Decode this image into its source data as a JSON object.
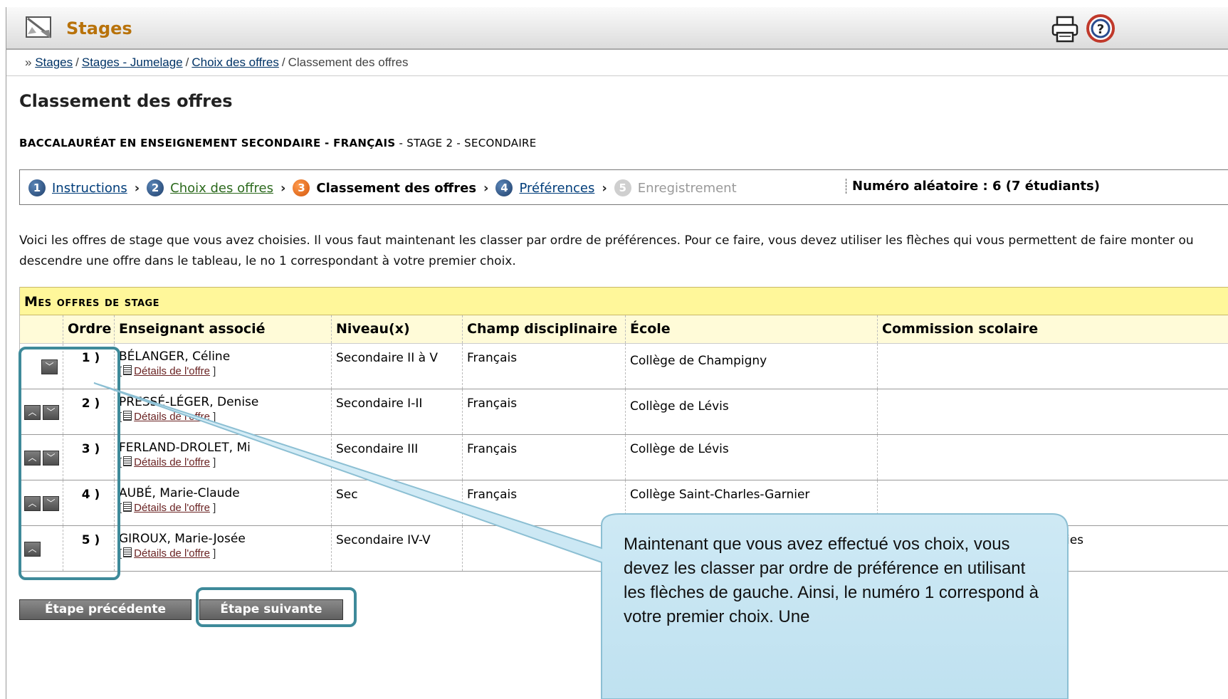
{
  "header": {
    "title": "Stages"
  },
  "breadcrumb": {
    "prefix": "»",
    "links": [
      "Stages",
      "Stages - Jumelage",
      "Choix des offres"
    ],
    "current": "Classement des offres"
  },
  "page_title": "Classement des offres",
  "program": {
    "bold": "BACCALAURÉAT EN ENSEIGNEMENT SECONDAIRE - FRANÇAIS",
    "rest": "- STAGE 2 - SECONDAIRE"
  },
  "steps": {
    "items": [
      {
        "num": "1",
        "label": "Instructions"
      },
      {
        "num": "2",
        "label": "Choix des offres"
      },
      {
        "num": "3",
        "label": "Classement des offres"
      },
      {
        "num": "4",
        "label": "Préférences"
      },
      {
        "num": "5",
        "label": "Enregistrement"
      }
    ],
    "random": "Numéro aléatoire : 6 (7 étudiants)"
  },
  "intro": "Voici les offres de stage que vous avez choisies. Il vous faut maintenant les classer par ordre de préférences. Pour ce faire, vous devez utiliser les flèches qui vous permettent de faire monter ou descendre une offre dans le tableau, le no 1 correspondant à votre premier choix.",
  "table": {
    "caption": "Mes offres de stage",
    "columns": [
      "Ordre",
      "Enseignant associé",
      "Niveau(x)",
      "Champ disciplinaire",
      "École",
      "Commission scolaire"
    ],
    "details_label": "Détails de l'offre",
    "rows": [
      {
        "order": "1 )",
        "teacher": "BÉLANGER, Céline",
        "level": "Secondaire II à V",
        "field": "Français",
        "school": "Collège de Champigny",
        "board": ""
      },
      {
        "order": "2 )",
        "teacher": "PRESSÉ-LÉGER, Denise",
        "level": "Secondaire I-II",
        "field": "Français",
        "school": "Collège de Lévis",
        "board": ""
      },
      {
        "order": "3 )",
        "teacher": "FERLAND-DROLET, Mi",
        "level": "Secondaire III",
        "field": "Français",
        "school": "Collège de Lévis",
        "board": ""
      },
      {
        "order": "4 )",
        "teacher": "AUBÉ, Marie-Claude",
        "level": "Sec",
        "field": "Français",
        "school": "Collège Saint-Charles-Garnier",
        "board": ""
      },
      {
        "order": "5 )",
        "teacher": "GIROUX, Marie-Josée",
        "level": "Secondaire IV-V",
        "field": "",
        "school": "",
        "board": "ries"
      }
    ]
  },
  "buttons": {
    "prev": "Étape précédente",
    "next": "Étape suivante"
  },
  "callout": "Maintenant que vous avez effectué vos choix, vous devez les classer par ordre de préférence en utilisant les flèches de gauche. Ainsi, le numéro 1 correspond à votre premier choix. Une",
  "colors": {
    "title": "#b8720a",
    "caption_bg": "#fff79a",
    "highlight": "#3e8a9a",
    "callout_bg": "#c9e6f3"
  }
}
